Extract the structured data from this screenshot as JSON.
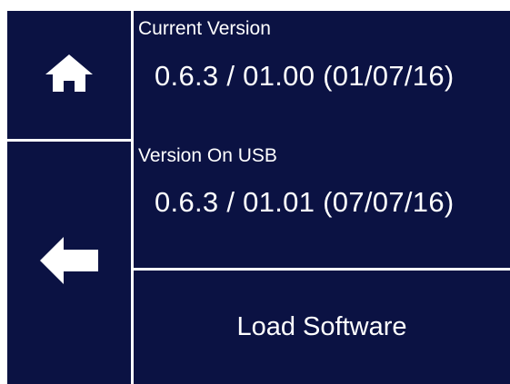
{
  "nav": {
    "home_icon": "home-icon",
    "back_icon": "back-arrow-icon"
  },
  "current_version": {
    "label": "Current Version",
    "value": "0.6.3 / 01.00 (01/07/16)"
  },
  "usb_version": {
    "label": "Version On USB",
    "value": "0.6.3 / 01.01 (07/07/16)"
  },
  "actions": {
    "load_label": "Load Software"
  },
  "colors": {
    "background": "#0b1243",
    "foreground": "#ffffff"
  }
}
